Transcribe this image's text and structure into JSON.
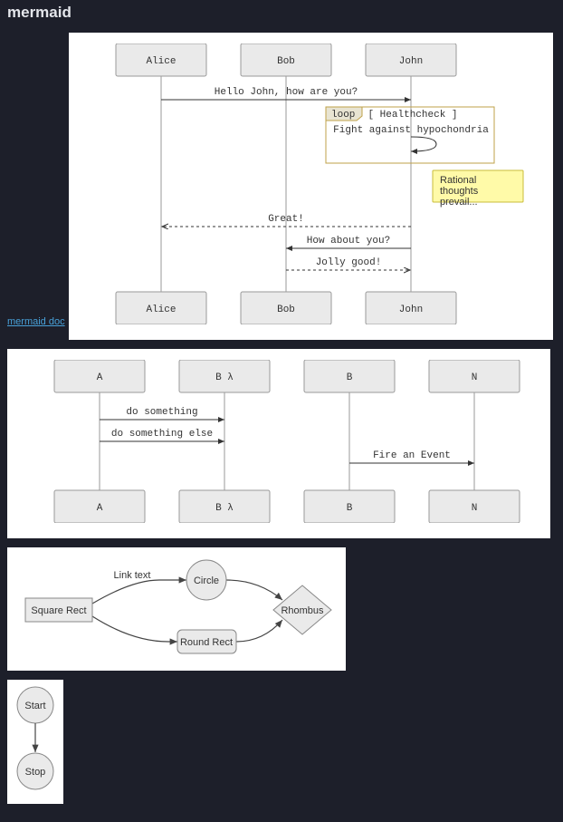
{
  "header": {
    "title": "mermaid",
    "link_label": "mermaid doc"
  },
  "seq1": {
    "actors": [
      "Alice",
      "Bob",
      "John"
    ],
    "msg1": "Hello John, how are you?",
    "loop_tag": "loop",
    "loop_title": "[ Healthcheck ]",
    "loop_msg": "Fight against hypochondria",
    "note": "Rational thoughts prevail...",
    "msg2": "Great!",
    "msg3": "How about you?",
    "msg4": "Jolly good!"
  },
  "seq2": {
    "actors": [
      "A",
      "B λ",
      "B",
      "N"
    ],
    "msg1": "do something",
    "msg2": "do something else",
    "msg3": "Fire an Event"
  },
  "flow1": {
    "n1": "Square Rect",
    "n2": "Circle",
    "n3": "Round Rect",
    "n4": "Rhombus",
    "edge_label": "Link text"
  },
  "flow2": {
    "n1": "Start",
    "n2": "Stop"
  },
  "chart_data": [
    {
      "type": "sequence",
      "actors": [
        "Alice",
        "Bob",
        "John"
      ],
      "messages": [
        {
          "from": "Alice",
          "to": "John",
          "text": "Hello John, how are you?",
          "style": "solid"
        },
        {
          "loop": "Healthcheck",
          "messages": [
            {
              "from": "John",
              "to": "John",
              "text": "Fight against hypochondria",
              "style": "solid"
            }
          ]
        },
        {
          "note": "Rational thoughts prevail...",
          "actor": "John",
          "side": "right"
        },
        {
          "from": "John",
          "to": "Alice",
          "text": "Great!",
          "style": "dashed"
        },
        {
          "from": "John",
          "to": "Bob",
          "text": "How about you?",
          "style": "solid"
        },
        {
          "from": "Bob",
          "to": "John",
          "text": "Jolly good!",
          "style": "dashed"
        }
      ]
    },
    {
      "type": "sequence",
      "actors": [
        "A",
        "B λ",
        "B",
        "N"
      ],
      "messages": [
        {
          "from": "A",
          "to": "B λ",
          "text": "do something",
          "style": "solid"
        },
        {
          "from": "A",
          "to": "B λ",
          "text": "do something else",
          "style": "solid"
        },
        {
          "from": "B",
          "to": "N",
          "text": "Fire an Event",
          "style": "solid"
        }
      ]
    },
    {
      "type": "flowchart",
      "nodes": [
        {
          "id": "A",
          "label": "Square Rect",
          "shape": "rect"
        },
        {
          "id": "B",
          "label": "Circle",
          "shape": "circle"
        },
        {
          "id": "C",
          "label": "Round Rect",
          "shape": "roundrect"
        },
        {
          "id": "D",
          "label": "Rhombus",
          "shape": "rhombus"
        }
      ],
      "edges": [
        {
          "from": "A",
          "to": "B",
          "label": "Link text"
        },
        {
          "from": "A",
          "to": "C"
        },
        {
          "from": "B",
          "to": "D"
        },
        {
          "from": "C",
          "to": "D"
        }
      ]
    },
    {
      "type": "flowchart",
      "nodes": [
        {
          "id": "S",
          "label": "Start",
          "shape": "circle"
        },
        {
          "id": "E",
          "label": "Stop",
          "shape": "circle"
        }
      ],
      "edges": [
        {
          "from": "S",
          "to": "E"
        }
      ]
    }
  ]
}
